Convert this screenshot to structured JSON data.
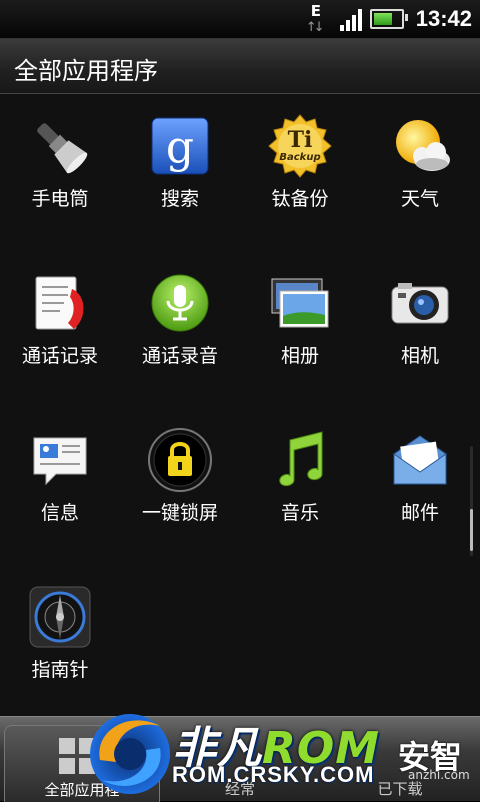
{
  "status_bar": {
    "network_type": "E",
    "network_arrows": "↑↓",
    "signal_bars": 4,
    "battery_level": 0.7,
    "time": "13:42"
  },
  "title_bar": {
    "title": "全部应用程序"
  },
  "apps": [
    {
      "label": "手电筒",
      "icon": "flashlight-icon"
    },
    {
      "label": "搜索",
      "icon": "google-search-icon"
    },
    {
      "label": "钛备份",
      "icon": "titanium-backup-icon"
    },
    {
      "label": "天气",
      "icon": "weather-icon"
    },
    {
      "label": "通话记录",
      "icon": "call-log-icon"
    },
    {
      "label": "通话录音",
      "icon": "call-recorder-icon"
    },
    {
      "label": "相册",
      "icon": "gallery-icon"
    },
    {
      "label": "相机",
      "icon": "camera-icon"
    },
    {
      "label": "信息",
      "icon": "messages-icon"
    },
    {
      "label": "一键锁屏",
      "icon": "lock-screen-icon"
    },
    {
      "label": "音乐",
      "icon": "music-icon"
    },
    {
      "label": "邮件",
      "icon": "mail-icon"
    },
    {
      "label": "指南针",
      "icon": "compass-icon"
    }
  ],
  "bottom_tabs": [
    {
      "label": "全部应用程",
      "icon": "all-apps-icon"
    },
    {
      "label": "经常",
      "icon": "frequent-icon"
    },
    {
      "label": "已下载",
      "icon": "downloaded-icon"
    }
  ],
  "watermark": {
    "brand_prefix": "非凡",
    "brand_rom": "ROM",
    "url": "ROM.CRSKY.COM",
    "anzhi_text": "安智",
    "anzhi_url": "anzhi.com"
  },
  "colors": {
    "background": "#111111",
    "accent_green": "#8fdc2e",
    "google_blue": "#2f6fd6",
    "titanium_gold": "#e8b52a"
  }
}
